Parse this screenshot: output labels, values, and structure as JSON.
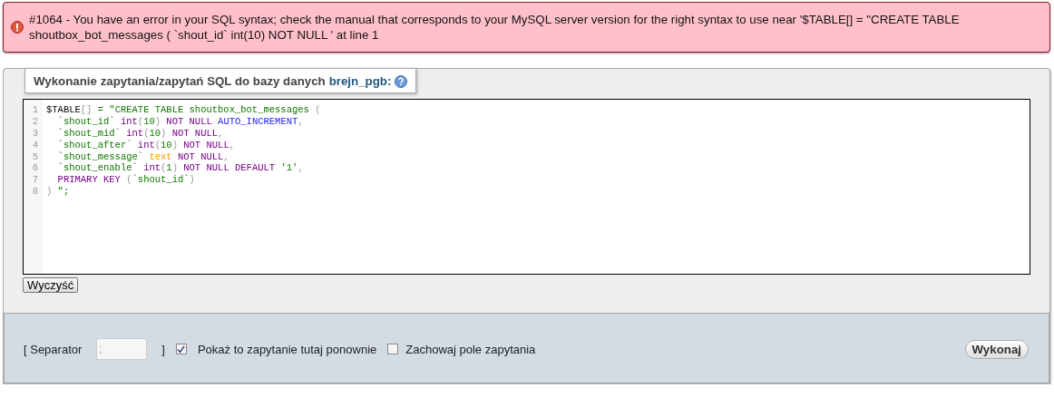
{
  "error": {
    "message": "#1064 - You have an error in your SQL syntax; check the manual that corresponds to your MySQL server version for the right syntax to use near '$TABLE[] = \"CREATE TABLE shoutbox_bot_messages ( `shout_id` int(10) NOT NULL ' at line 1"
  },
  "query_panel": {
    "legend": "Wykonanie zapytania/zapytań SQL do bazy danych",
    "database": "brejn_pgb:",
    "editor": {
      "lines": [
        {
          "number": "1",
          "tokens": [
            {
              "text": "$TABLE",
              "kind": "plain"
            },
            {
              "text": "[]",
              "kind": "punct"
            },
            {
              "text": " = \"CREATE TABLE shoutbox_bot_messages ",
              "kind": "string"
            },
            {
              "text": "(",
              "kind": "punct"
            }
          ]
        },
        {
          "number": "2",
          "tokens": [
            {
              "text": "  `shout_id` ",
              "kind": "string"
            },
            {
              "text": "int",
              "kind": "keyword"
            },
            {
              "text": "(",
              "kind": "punct"
            },
            {
              "text": "10",
              "kind": "string"
            },
            {
              "text": ")",
              "kind": "punct"
            },
            {
              "text": " NOT NULL ",
              "kind": "keyword"
            },
            {
              "text": "AUTO_INCREMENT",
              "kind": "builtin"
            },
            {
              "text": ",",
              "kind": "punct"
            }
          ]
        },
        {
          "number": "3",
          "tokens": [
            {
              "text": "  `shout_mid` ",
              "kind": "string"
            },
            {
              "text": "int",
              "kind": "keyword"
            },
            {
              "text": "(",
              "kind": "punct"
            },
            {
              "text": "10",
              "kind": "string"
            },
            {
              "text": ")",
              "kind": "punct"
            },
            {
              "text": " NOT NULL",
              "kind": "keyword"
            },
            {
              "text": ",",
              "kind": "punct"
            }
          ]
        },
        {
          "number": "4",
          "tokens": [
            {
              "text": "  `shout_after` ",
              "kind": "string"
            },
            {
              "text": "int",
              "kind": "keyword"
            },
            {
              "text": "(",
              "kind": "punct"
            },
            {
              "text": "10",
              "kind": "string"
            },
            {
              "text": ")",
              "kind": "punct"
            },
            {
              "text": " NOT NULL",
              "kind": "keyword"
            },
            {
              "text": ",",
              "kind": "punct"
            }
          ]
        },
        {
          "number": "5",
          "tokens": [
            {
              "text": "  `shout_message` ",
              "kind": "string"
            },
            {
              "text": "text",
              "kind": "type"
            },
            {
              "text": " NOT NULL",
              "kind": "keyword"
            },
            {
              "text": ",",
              "kind": "punct"
            }
          ]
        },
        {
          "number": "6",
          "tokens": [
            {
              "text": "  `shout_enable` ",
              "kind": "string"
            },
            {
              "text": "int",
              "kind": "keyword"
            },
            {
              "text": "(",
              "kind": "punct"
            },
            {
              "text": "1",
              "kind": "string"
            },
            {
              "text": ")",
              "kind": "punct"
            },
            {
              "text": " NOT NULL DEFAULT ",
              "kind": "keyword"
            },
            {
              "text": "'1'",
              "kind": "string"
            },
            {
              "text": ",",
              "kind": "punct"
            }
          ]
        },
        {
          "number": "7",
          "tokens": [
            {
              "text": "  PRIMARY KEY ",
              "kind": "keyword"
            },
            {
              "text": "(",
              "kind": "punct"
            },
            {
              "text": "`shout_id`",
              "kind": "string"
            },
            {
              "text": ")",
              "kind": "punct"
            }
          ]
        },
        {
          "number": "8",
          "tokens": [
            {
              "text": ") ",
              "kind": "punct"
            },
            {
              "text": "\";",
              "kind": "string"
            }
          ]
        }
      ]
    },
    "clear_button": "Wyczyść"
  },
  "options": {
    "separator_open": "[ Separator",
    "separator_value": ";",
    "separator_close": "]",
    "checkboxes": [
      {
        "label": "Pokaż to zapytanie tutaj ponownie",
        "checked": true
      },
      {
        "label": "Zachowaj pole zapytania",
        "checked": false
      }
    ],
    "submit_button": "Wykonaj"
  }
}
